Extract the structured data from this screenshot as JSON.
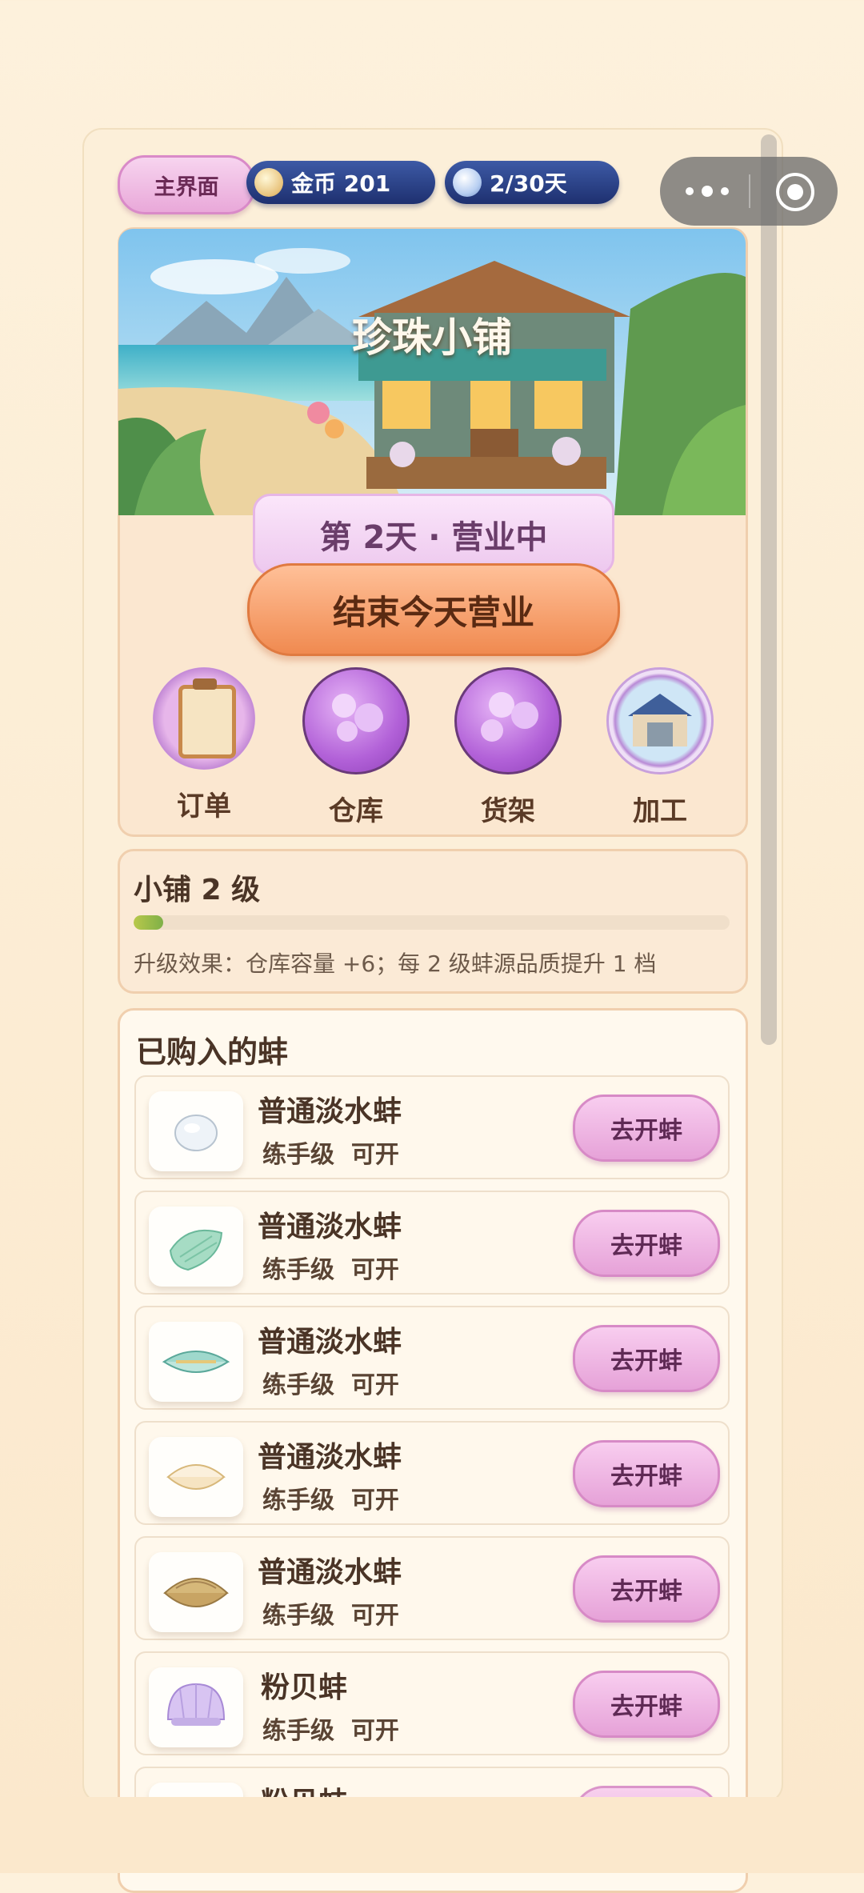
{
  "header": {
    "home_label": "主界面",
    "coin_label": "金币 201",
    "day_label": "2/30天"
  },
  "shop": {
    "title": "珍珠小铺",
    "status": "第 2天 · 营业中",
    "end_button": "结束今天营业"
  },
  "menu": [
    {
      "label": "订单",
      "icon": "order-clipboard-icon"
    },
    {
      "label": "仓库",
      "icon": "warehouse-pearls-icon"
    },
    {
      "label": "货架",
      "icon": "shelf-pearls-icon"
    },
    {
      "label": "加工",
      "icon": "workshop-icon"
    }
  ],
  "level": {
    "title": "小铺 2 级",
    "progress_fraction": 0.05,
    "effect": "升级效果：仓库容量 +6；每 2 级蚌源品质提升 1 档"
  },
  "bought": {
    "title": "已购入的蚌",
    "items": [
      {
        "name": "普通淡水蚌",
        "grade": "练手级",
        "state": "可开",
        "button": "去开蚌",
        "icon": "white-pearl-icon"
      },
      {
        "name": "普通淡水蚌",
        "grade": "练手级",
        "state": "可开",
        "button": "去开蚌",
        "icon": "green-shell-icon"
      },
      {
        "name": "普通淡水蚌",
        "grade": "练手级",
        "state": "可开",
        "button": "去开蚌",
        "icon": "teal-clam-icon"
      },
      {
        "name": "普通淡水蚌",
        "grade": "练手级",
        "state": "可开",
        "button": "去开蚌",
        "icon": "cream-clam-icon"
      },
      {
        "name": "普通淡水蚌",
        "grade": "练手级",
        "state": "可开",
        "button": "去开蚌",
        "icon": "oyster-icon"
      },
      {
        "name": "粉贝蚌",
        "grade": "练手级",
        "state": "可开",
        "button": "去开蚌",
        "icon": "pink-shell-icon"
      },
      {
        "name": "粉贝蚌",
        "grade": "",
        "state": "",
        "button": "",
        "icon": "pink-shell-icon"
      }
    ]
  },
  "colors": {
    "background": "#fbe8cc",
    "resource_pill": "#2a3f86",
    "pink_button": "#e6a2d8",
    "end_button": "#f08a50"
  }
}
